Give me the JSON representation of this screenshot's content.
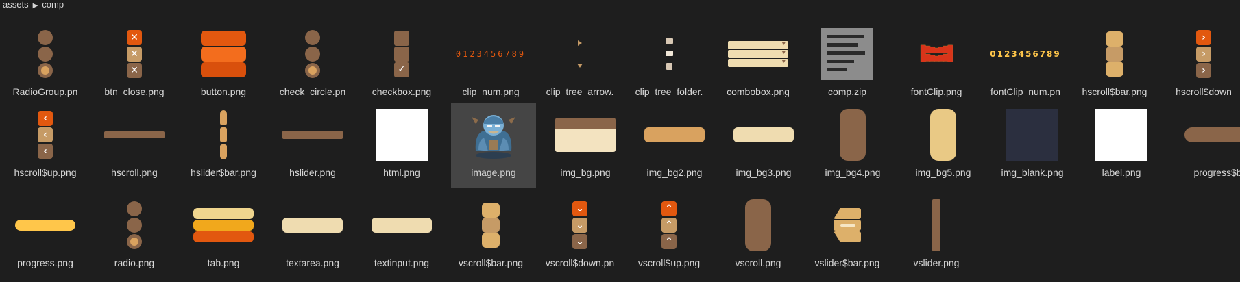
{
  "breadcrumb": {
    "root": "assets",
    "separator": "▶",
    "current": "comp"
  },
  "clip_num_digits": "0123456789",
  "fontclip_num_digits": "0123456789",
  "fontclip_glyphs": "█▇▆▅▆▇█",
  "files": [
    {
      "name": "RadioGroup.pn",
      "icon": "radiogroup-icon"
    },
    {
      "name": "btn_close.png",
      "icon": "close-button-icon"
    },
    {
      "name": "button.png",
      "icon": "button-icon"
    },
    {
      "name": "check_circle.pn",
      "icon": "check-circle-icon"
    },
    {
      "name": "checkbox.png",
      "icon": "checkbox-icon"
    },
    {
      "name": "clip_num.png",
      "icon": "digits-icon"
    },
    {
      "name": "clip_tree_arrow.",
      "icon": "tree-arrow-icon"
    },
    {
      "name": "clip_tree_folder.",
      "icon": "tree-folder-icon"
    },
    {
      "name": "combobox.png",
      "icon": "combobox-icon"
    },
    {
      "name": "comp.zip",
      "icon": "zip-file-icon"
    },
    {
      "name": "fontClip.png",
      "icon": "font-clip-icon"
    },
    {
      "name": "fontClip_num.pn",
      "icon": "font-digits-icon"
    },
    {
      "name": "hscroll$bar.png",
      "icon": "scrollbar-icon"
    },
    {
      "name": "hscroll$down",
      "icon": "scroll-down-icon"
    },
    {
      "name": "hscroll$up.png",
      "icon": "scroll-up-icon"
    },
    {
      "name": "hscroll.png",
      "icon": "hscroll-icon"
    },
    {
      "name": "hslider$bar.png",
      "icon": "slider-bar-icon"
    },
    {
      "name": "hslider.png",
      "icon": "hslider-icon"
    },
    {
      "name": "html.png",
      "icon": "blank-image-icon"
    },
    {
      "name": "image.png",
      "icon": "character-image-icon"
    },
    {
      "name": "img_bg.png",
      "icon": "panel-bg-icon"
    },
    {
      "name": "img_bg2.png",
      "icon": "bar-bg-icon"
    },
    {
      "name": "img_bg3.png",
      "icon": "bar-bg-icon"
    },
    {
      "name": "img_bg4.png",
      "icon": "rounded-bg-icon"
    },
    {
      "name": "img_bg5.png",
      "icon": "rounded-bg-icon"
    },
    {
      "name": "img_blank.png",
      "icon": "blank-dark-icon"
    },
    {
      "name": "label.png",
      "icon": "blank-image-icon"
    },
    {
      "name": "progress$bar",
      "icon": "progress-bar-icon"
    },
    {
      "name": "progress.png",
      "icon": "progress-icon"
    },
    {
      "name": "radio.png",
      "icon": "radio-icon"
    },
    {
      "name": "tab.png",
      "icon": "tab-icon"
    },
    {
      "name": "textarea.png",
      "icon": "textarea-icon"
    },
    {
      "name": "textinput.png",
      "icon": "textinput-icon"
    },
    {
      "name": "vscroll$bar.png",
      "icon": "scrollbar-icon"
    },
    {
      "name": "vscroll$down.pn",
      "icon": "scroll-down-icon"
    },
    {
      "name": "vscroll$up.png",
      "icon": "scroll-up-icon"
    },
    {
      "name": "vscroll.png",
      "icon": "vscroll-icon"
    },
    {
      "name": "vslider$bar.png",
      "icon": "slider-bar-icon"
    },
    {
      "name": "vslider.png",
      "icon": "vslider-icon"
    }
  ],
  "selected_file": "image.png",
  "colors": {
    "background": "#1e1e1e",
    "selected": "#454545",
    "text": "#d6d6d6",
    "orange": "#e2580f",
    "brown": "#8a6549",
    "tan": "#c69b66",
    "cream": "#efdcb0",
    "yellow": "#ffc64a"
  }
}
